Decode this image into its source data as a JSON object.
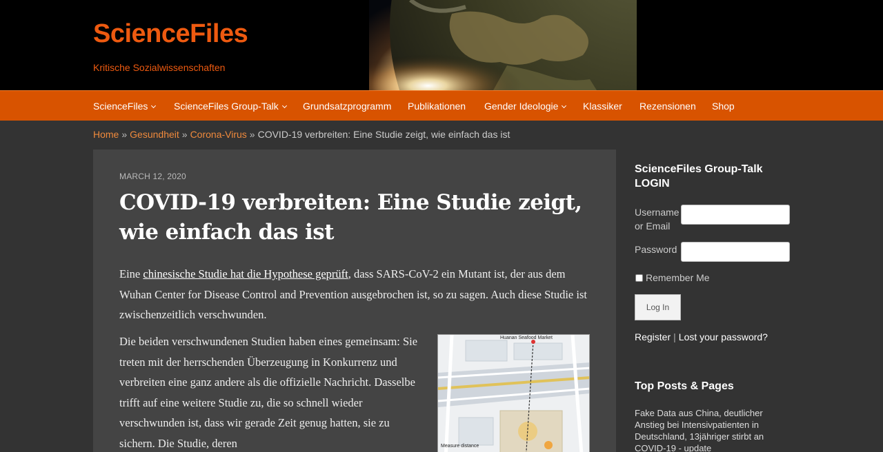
{
  "header": {
    "site_title": "ScienceFiles",
    "tagline": "Kritische Sozialwissenschaften"
  },
  "nav": {
    "items": [
      {
        "label": "ScienceFiles",
        "has_dropdown": true
      },
      {
        "label": "ScienceFiles Group-Talk",
        "has_dropdown": true
      },
      {
        "label": "Grundsatzprogramm",
        "has_dropdown": false
      },
      {
        "label": "Publikationen",
        "has_dropdown": false
      },
      {
        "label": "Gender Ideologie",
        "has_dropdown": true
      },
      {
        "label": "Klassiker",
        "has_dropdown": false
      },
      {
        "label": "Rezensionen",
        "has_dropdown": false
      },
      {
        "label": "Shop",
        "has_dropdown": false
      }
    ]
  },
  "breadcrumb": {
    "home": "Home",
    "cat1": "Gesundheit",
    "cat2": "Corona-Virus",
    "current": "COVID-19 verbreiten: Eine Studie zeigt, wie einfach das ist",
    "separator": "»"
  },
  "article": {
    "date": "March 12, 2020",
    "title": "COVID-19 verbreiten: Eine Studie zeigt, wie einfach das ist",
    "p1_before": "Eine ",
    "p1_link": "chinesische Studie hat die Hypothese geprüft",
    "p1_after": ", dass SARS-CoV-2 ein Mutant ist, der aus dem Wuhan Center for Disease Control and Prevention ausgebrochen ist, so zu sagen. Auch diese Studie ist zwischenzeitlich verschwunden.",
    "p2": "Die beiden verschwundenen Studien haben eines gemeinsam: Sie treten mit der herrschenden Überzeugung in Konkurrenz und verbreiten eine ganz andere als die offizielle Nachricht. Dasselbe trifft auf eine weitere Studie zu, die so schnell wieder verschwunden ist, dass wir gerade Zeit genug hatten, sie zu sichern. Die Studie, deren",
    "figure": {
      "map_title": "Huanan Seafood Market",
      "measure_label": "Measure distance"
    }
  },
  "sidebar": {
    "login_title": "ScienceFiles Group-Talk LOGIN",
    "username_label": "Username or Email",
    "password_label": "Password",
    "remember_label": "Remember Me",
    "login_button": "Log In",
    "register_link": "Register",
    "lost_password_link": "Lost your password?",
    "top_posts_title": "Top Posts & Pages",
    "top_posts": [
      "Fake Data aus China, deutlicher Anstieg bei Intensivpatienten in Deutschland, 13jähriger stirbt an COVID-19 - update"
    ]
  },
  "colors": {
    "accent": "#ee5a10",
    "nav_bg": "#d85300",
    "page_bg": "#333333",
    "article_bg": "#444444"
  }
}
